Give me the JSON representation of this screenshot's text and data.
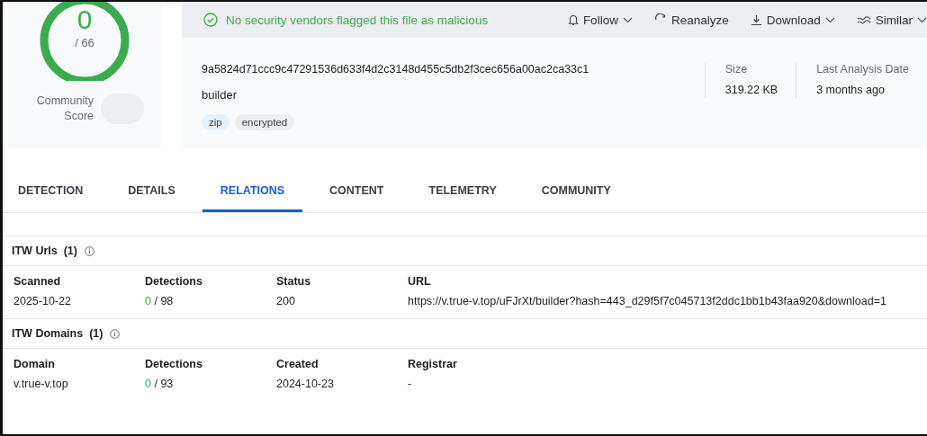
{
  "score": {
    "value": "0",
    "total": "/ 66",
    "label": "Community Score"
  },
  "banner": {
    "text": "No security vendors flagged this file as malicious"
  },
  "actions": [
    {
      "label": "Follow",
      "kind": "bell",
      "dropdown": true
    },
    {
      "label": "Reanalyze",
      "kind": "refresh",
      "dropdown": false
    },
    {
      "label": "Download",
      "kind": "download",
      "dropdown": true
    },
    {
      "label": "Similar",
      "kind": "similar",
      "dropdown": true
    }
  ],
  "file": {
    "hash": "9a5824d71ccc9c47291536d633f4d2c3148d455c5db2f3cec656a00ac2ca33c1",
    "name": "builder",
    "tags": [
      {
        "label": "zip",
        "color": "#e6f2fb"
      },
      {
        "label": "encrypted",
        "color": "#eceef2"
      }
    ],
    "stats": [
      {
        "label": "Size",
        "value": "319.22 KB"
      },
      {
        "label": "Last Analysis Date",
        "value": "3 months ago"
      }
    ]
  },
  "tabs": [
    {
      "label": "DETECTION",
      "selected": false
    },
    {
      "label": "DETAILS",
      "selected": false
    },
    {
      "label": "RELATIONS",
      "selected": true
    },
    {
      "label": "CONTENT",
      "selected": false
    },
    {
      "label": "TELEMETRY",
      "selected": false
    },
    {
      "label": "COMMUNITY",
      "selected": false
    }
  ],
  "sections": [
    {
      "title": "ITW Urls",
      "count": "(1)",
      "columns": [
        "Scanned",
        "Detections",
        "Status",
        "URL"
      ],
      "rows": [
        [
          {
            "kind": "text",
            "text": "2025-10-22"
          },
          {
            "kind": "detections",
            "hits": "0",
            "total": "/ 98"
          },
          {
            "kind": "text",
            "text": "200"
          },
          {
            "kind": "text",
            "text": "https://v.true-v.top/uFJrXt/builder?hash=443_d29f5f7c045713f2ddc1bb1b43faa920&download=1"
          }
        ]
      ]
    },
    {
      "title": "ITW Domains",
      "count": "(1)",
      "columns": [
        "Domain",
        "Detections",
        "Created",
        "Registrar"
      ],
      "rows": [
        [
          {
            "kind": "text",
            "text": "v.true-v.top"
          },
          {
            "kind": "detections",
            "hits": "0",
            "total": "/ 93"
          },
          {
            "kind": "text",
            "text": "2024-10-23"
          },
          {
            "kind": "text",
            "text": "-"
          }
        ]
      ]
    }
  ]
}
